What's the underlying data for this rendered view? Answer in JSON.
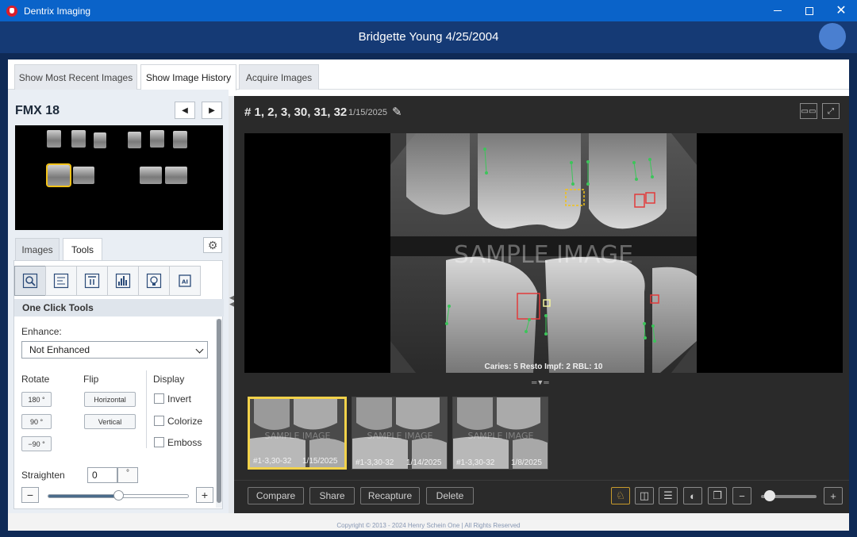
{
  "window": {
    "title": "Dentrix Imaging"
  },
  "header": {
    "patient": "Bridgette Young 4/25/2004"
  },
  "main_tabs": [
    {
      "label": "Show Most Recent Images"
    },
    {
      "label": "Show Image History",
      "active": true
    },
    {
      "label": "Acquire Images"
    }
  ],
  "left": {
    "series_title": "FMX 18",
    "sub_tabs": [
      {
        "label": "Images"
      },
      {
        "label": "Tools",
        "active": true
      }
    ],
    "tool_icons": [
      "magnify-select-icon",
      "measure-icon",
      "text-icon",
      "histogram-icon",
      "lightbulb-icon",
      "ai-icon"
    ],
    "section_title": "One Click Tools",
    "enhance_label": "Enhance:",
    "enhance_value": "Not Enhanced",
    "rotate_label": "Rotate",
    "rotate_buttons": [
      "180 °",
      "90 °",
      "−90 °"
    ],
    "flip_label": "Flip",
    "flip_buttons": [
      "Horizontal",
      "Vertical"
    ],
    "display_label": "Display",
    "display_options": [
      "Invert",
      "Colorize",
      "Emboss"
    ],
    "straighten_label": "Straighten",
    "straighten_value": "0",
    "straighten_unit": "°",
    "straighten_level": 0.5
  },
  "viewer": {
    "title": "# 1, 2, 3, 30, 31, 32",
    "date": "1/15/2025",
    "watermark": "SAMPLE IMAGE",
    "caption": "Caries: 5 Resto Impf: 2 RBL: 10",
    "history": [
      {
        "label": "#1-3,30-32",
        "date": "1/15/2025",
        "selected": true
      },
      {
        "label": "#1-3,30-32",
        "date": "1/14/2025"
      },
      {
        "label": "#1-3,30-32",
        "date": "1/8/2025"
      }
    ],
    "actions": [
      "Compare",
      "Share",
      "Recapture",
      "Delete"
    ],
    "zoom_level": 0.15
  },
  "footer": {
    "copyright": "Copyright © 2013 - 2024 Henry Schein One | All Rights Reserved"
  },
  "colors": {
    "titlebar": "#0a63c9",
    "header": "#153a75",
    "accent": "#f2c218",
    "annotation_red": "#e23b3b",
    "annotation_green": "#3cc55a"
  }
}
